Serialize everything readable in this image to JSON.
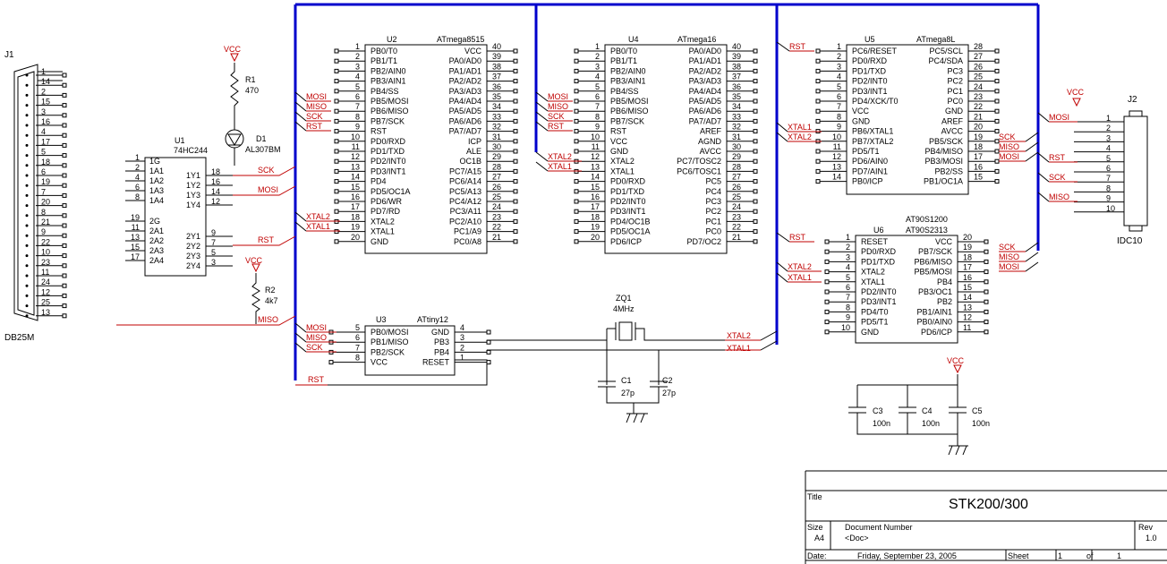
{
  "title_block": {
    "title_label": "Title",
    "title": "STK200/300",
    "size_label": "Size",
    "size": "A4",
    "docnum_label": "Document Number",
    "docnum": "<Doc>",
    "rev_label": "Rev",
    "rev": "1.0",
    "date_label": "Date:",
    "date": "Friday, September 23, 2005",
    "sheet_label": "Sheet",
    "sheet": "1",
    "of_label": "of",
    "of": "1"
  },
  "j1": {
    "ref": "J1",
    "name": "DB25M",
    "pins": [
      "1",
      "14",
      "2",
      "15",
      "3",
      "16",
      "4",
      "17",
      "5",
      "18",
      "6",
      "19",
      "7",
      "20",
      "8",
      "21",
      "9",
      "22",
      "10",
      "23",
      "11",
      "24",
      "12",
      "25",
      "13"
    ]
  },
  "j2": {
    "ref": "J2",
    "name": "IDC10",
    "pins": [
      "1",
      "2",
      "3",
      "4",
      "5",
      "6",
      "7",
      "8",
      "9",
      "10"
    ]
  },
  "u1": {
    "ref": "U1",
    "name": "74HC244",
    "left_nums": [
      "1",
      "2",
      "4",
      "6",
      "8",
      "19",
      "11",
      "13",
      "15",
      "17"
    ],
    "left_labels": [
      "1G",
      "1A1",
      "1A2",
      "1A3",
      "1A4",
      "2G",
      "2A1",
      "2A2",
      "2A3",
      "2A4"
    ],
    "right_nums": [
      "18",
      "16",
      "14",
      "12",
      "9",
      "7",
      "5",
      "3"
    ],
    "right_labels": [
      "1Y1",
      "1Y2",
      "1Y3",
      "1Y4",
      "2Y1",
      "2Y2",
      "2Y3",
      "2Y4"
    ]
  },
  "u2": {
    "ref": "U2",
    "name": "ATmega8515",
    "left_nums": [
      "1",
      "2",
      "3",
      "4",
      "5",
      "6",
      "7",
      "8",
      "9",
      "10",
      "11",
      "12",
      "13",
      "14",
      "15",
      "16",
      "17",
      "18",
      "19",
      "20"
    ],
    "left_labels": [
      "PB0/T0",
      "PB1/T1",
      "PB2/AIN0",
      "PB3/AIN1",
      "PB4/SS",
      "PB5/MOSI",
      "PB6/MISO",
      "PB7/SCK",
      "RST",
      "PD0/RXD",
      "PD1/TXD",
      "PD2/INT0",
      "PD3/INT1",
      "PD4",
      "PD5/OC1A",
      "PD6/WR",
      "PD7/RD",
      "XTAL2",
      "XTAL1",
      "GND"
    ],
    "right_nums": [
      "40",
      "39",
      "38",
      "37",
      "36",
      "35",
      "34",
      "33",
      "32",
      "31",
      "30",
      "29",
      "28",
      "27",
      "26",
      "25",
      "24",
      "23",
      "22",
      "21"
    ],
    "right_labels": [
      "VCC",
      "PA0/AD0",
      "PA1/AD1",
      "PA2/AD2",
      "PA3/AD3",
      "PA4/AD4",
      "PA5/AD5",
      "PA6/AD6",
      "PA7/AD7",
      "ICP",
      "ALE",
      "OC1B",
      "PC7/A15",
      "PC6/A14",
      "PC5/A13",
      "PC4/A12",
      "PC3/A11",
      "PC2/A10",
      "PC1/A9",
      "PC0/A8"
    ]
  },
  "u4": {
    "ref": "U4",
    "name": "ATmega16",
    "left_nums": [
      "1",
      "2",
      "3",
      "4",
      "5",
      "6",
      "7",
      "8",
      "9",
      "10",
      "11",
      "12",
      "13",
      "14",
      "15",
      "16",
      "17",
      "18",
      "19",
      "20"
    ],
    "left_labels": [
      "PB0/T0",
      "PB1/T1",
      "PB2/AIN0",
      "PB3/AIN1",
      "PB4/SS",
      "PB5/MOSI",
      "PB6/MISO",
      "PB7/SCK",
      "RST",
      "VCC",
      "GND",
      "XTAL2",
      "XTAL1",
      "PD0/RXD",
      "PD1/TXD",
      "PD2/INT0",
      "PD3/INT1",
      "PD4/OC1B",
      "PD5/OC1A",
      "PD6/ICP"
    ],
    "right_nums": [
      "40",
      "39",
      "38",
      "37",
      "36",
      "35",
      "34",
      "33",
      "32",
      "31",
      "30",
      "29",
      "28",
      "27",
      "26",
      "25",
      "24",
      "23",
      "22",
      "21"
    ],
    "right_labels": [
      "PA0/AD0",
      "PA1/AD1",
      "PA2/AD2",
      "PA3/AD3",
      "PA4/AD4",
      "PA5/AD5",
      "PA6/AD6",
      "PA7/AD7",
      "AREF",
      "AGND",
      "AVCC",
      "PC7/TOSC2",
      "PC6/TOSC1",
      "PC5",
      "PC4",
      "PC3",
      "PC2",
      "PC1",
      "PC0",
      "PD7/OC2"
    ]
  },
  "u5": {
    "ref": "U5",
    "name": "ATmega8L",
    "left_nums": [
      "1",
      "2",
      "3",
      "4",
      "5",
      "6",
      "7",
      "8",
      "9",
      "10",
      "11",
      "12",
      "13",
      "14"
    ],
    "left_labels": [
      "PC6/RESET",
      "PD0/RXD",
      "PD1/TXD",
      "PD2/INT0",
      "PD3/INT1",
      "PD4/XCK/T0",
      "VCC",
      "GND",
      "PB6/XTAL1",
      "PB7/XTAL2",
      "PD5/T1",
      "PD6/AIN0",
      "PD7/AIN1",
      "PB0/ICP"
    ],
    "right_nums": [
      "28",
      "27",
      "26",
      "25",
      "24",
      "23",
      "22",
      "21",
      "20",
      "19",
      "18",
      "17",
      "16",
      "15"
    ],
    "right_labels": [
      "PC5/SCL",
      "PC4/SDA",
      "PC3",
      "PC2",
      "PC1",
      "PC0",
      "GND",
      "AREF",
      "AVCC",
      "PB5/SCK",
      "PB4/MISO",
      "PB3/MOSI",
      "PB2/SS",
      "PB1/OC1A"
    ]
  },
  "u6": {
    "ref": "U6",
    "name": "AT90S1200",
    "name2": "AT90S2313",
    "left_nums": [
      "1",
      "2",
      "3",
      "4",
      "5",
      "6",
      "7",
      "8",
      "9",
      "10"
    ],
    "left_labels": [
      "RESET",
      "PD0/RXD",
      "PD1/TXD",
      "XTAL2",
      "XTAL1",
      "PD2/INT0",
      "PD3/INT1",
      "PD4/T0",
      "PD5/T1",
      "GND"
    ],
    "right_nums": [
      "20",
      "19",
      "18",
      "17",
      "16",
      "15",
      "14",
      "13",
      "12",
      "11"
    ],
    "right_labels": [
      "VCC",
      "PB7/SCK",
      "PB6/MISO",
      "PB5/MOSI",
      "PB4",
      "PB3/OC1",
      "PB2",
      "PB1/AIN1",
      "PB0/AIN0",
      "PD6/ICP"
    ]
  },
  "u3": {
    "ref": "U3",
    "name": "ATtiny12",
    "left_nums": [
      "5",
      "6",
      "7",
      "8"
    ],
    "left_labels": [
      "PB0/MOSI",
      "PB1/MISO",
      "PB2/SCK",
      "VCC"
    ],
    "right_nums": [
      "4",
      "3",
      "2",
      "1"
    ],
    "right_labels": [
      "GND",
      "PB3",
      "PB4",
      "RESET"
    ]
  },
  "parts": {
    "r1_ref": "R1",
    "r1_val": "470",
    "r2_ref": "R2",
    "r2_val": "4k7",
    "d1_ref": "D1",
    "d1_val": "AL307BM",
    "zq1_ref": "ZQ1",
    "zq1_val": "4MHz",
    "c1_ref": "C1",
    "c1_val": "27p",
    "c2_ref": "C2",
    "c2_val": "27p",
    "c3_ref": "C3",
    "c3_val": "100n",
    "c4_ref": "C4",
    "c4_val": "100n",
    "c5_ref": "C5",
    "c5_val": "100n",
    "vcc": "VCC"
  },
  "nets": {
    "sck": "SCK",
    "mosi": "MOSI",
    "miso": "MISO",
    "rst": "RST",
    "xtal1": "XTAL1",
    "xtal2": "XTAL2"
  },
  "colors": {
    "bus": "#0000cc",
    "net": "#c00000",
    "wire": "#000000"
  }
}
